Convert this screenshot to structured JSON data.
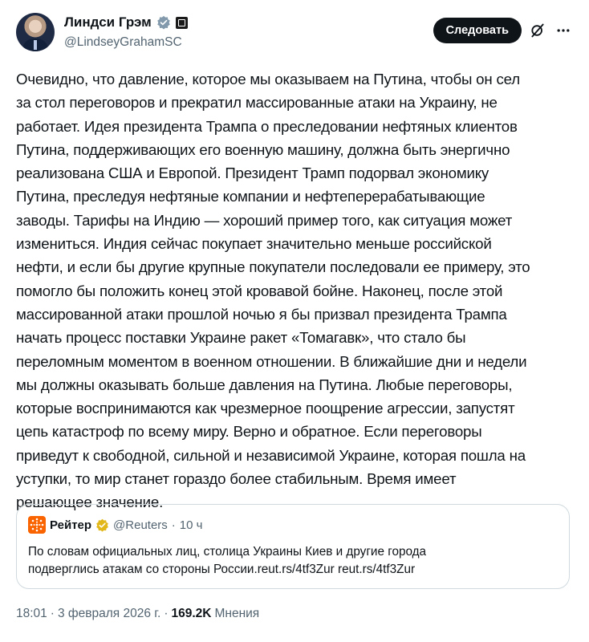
{
  "author": {
    "name": "Линдси Грэм",
    "handle": "@LindseyGrahamSC",
    "verified_color": "#829aab"
  },
  "actions": {
    "follow_label": "Следовать"
  },
  "tweet": {
    "lines": [
      "Очевидно, что давление, которое мы оказываем на Путина, чтобы он сел",
      "за стол переговоров и прекратил массированные атаки на Украину, не",
      "работает. Идея президента Трампа о преследовании нефтяных клиентов",
      "Путина, поддерживающих его военную машину, должна быть энергично",
      "реализована США и Европой. Президент Трамп подорвал экономику",
      "Путина, преследуя нефтяные компании и нефтеперерабатывающие",
      "заводы. Тарифы на Индию — хороший пример того, как ситуация может",
      "измениться. Индия сейчас покупает значительно меньше российской",
      "нефти, и если бы другие крупные покупатели последовали ее примеру, это",
      "помогло бы положить конец этой кровавой бойне. Наконец, после этой",
      "массированной атаки прошлой ночью я бы призвал президента Трампа",
      "начать процесс поставки Украине ракет «Томагавк», что стало бы",
      "переломным моментом в военном отношении. В ближайшие дни и недели",
      "мы должны оказывать больше давления на Путина. Любые переговоры,",
      "которые воспринимаются как чрезмерное поощрение агрессии, запустят",
      "цепь катастроф по всему миру. Верно и обратное. Если переговоры",
      "приведут к свободной, сильной и независимой Украине, которая пошла на",
      "уступки, то мир станет гораздо более стабильным. Время имеет",
      "решающее значение."
    ]
  },
  "quote": {
    "name": "Рейтер",
    "handle": "@Reuters",
    "separator": "·",
    "time": "10 ч",
    "lines": [
      "По словам официальных лиц, столица Украины Киев и другие города",
      "подверглись атакам со стороны России.reut.rs/4tf3Zur reut.rs/4tf3Zur"
    ],
    "brand_color": "#fa6400",
    "verified_color": "#e2b719"
  },
  "footer": {
    "time": "18:01",
    "separator1": "·",
    "date": "3 февраля 2026 г.",
    "separator2": "·",
    "views_count": "169.2K",
    "views_label": "Мнения"
  }
}
